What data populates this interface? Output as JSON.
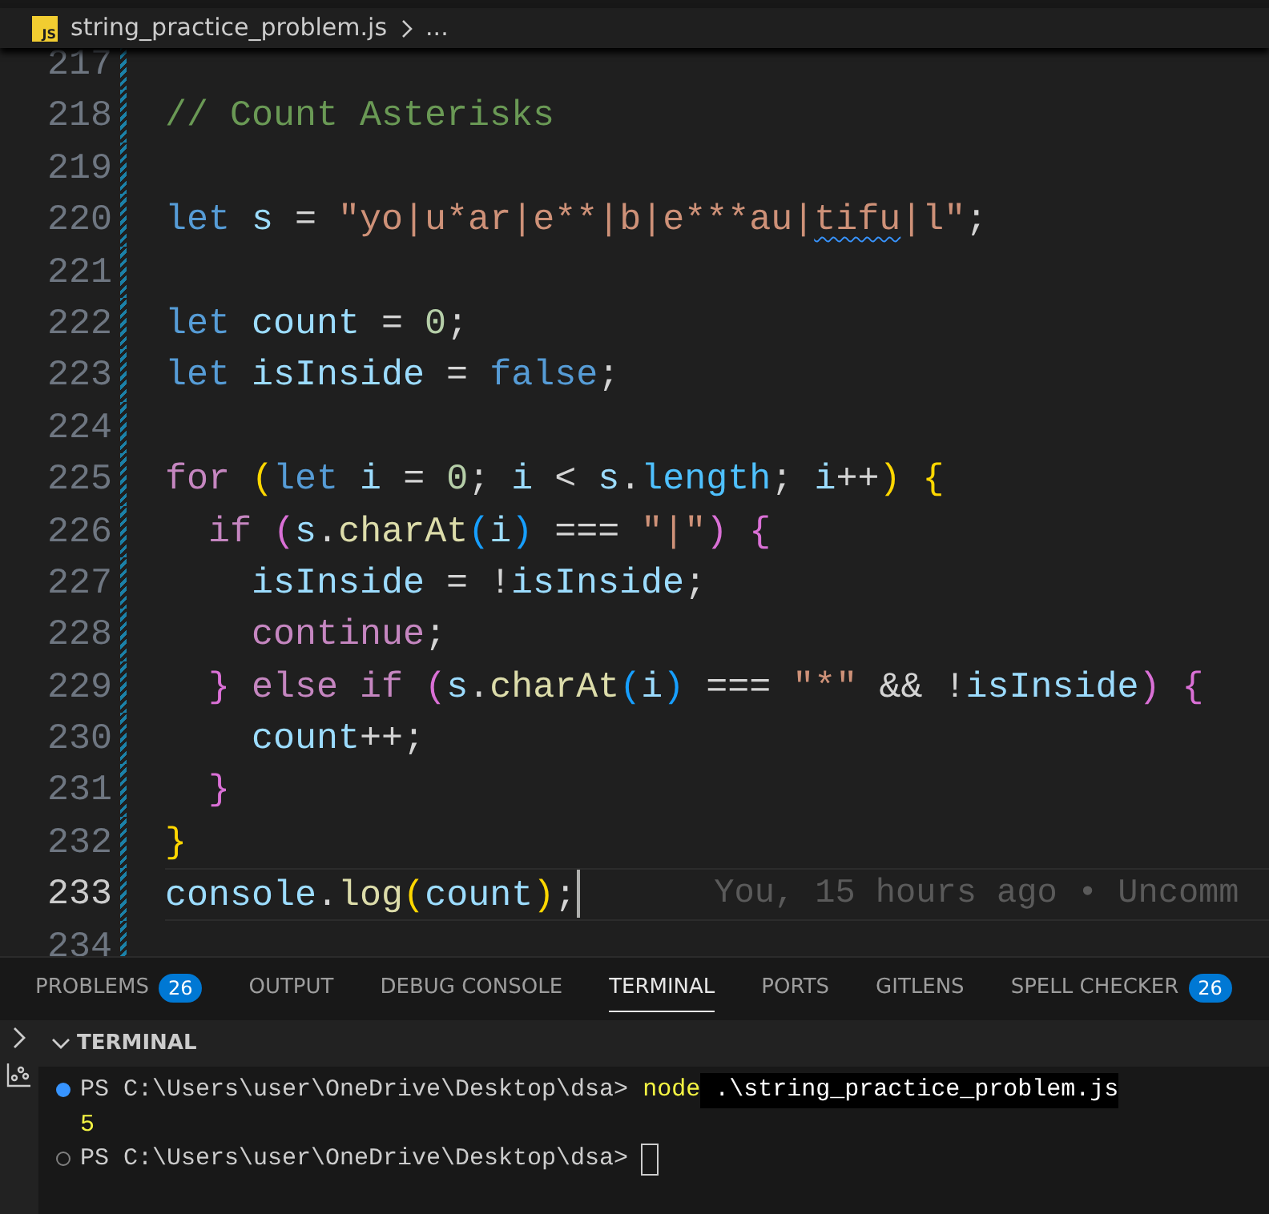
{
  "breadcrumb": {
    "file_icon": "JS",
    "file": "string_practice_problem.js",
    "more": "..."
  },
  "code_lines": [
    {
      "number": "217"
    },
    {
      "number": "218",
      "tokens": [
        {
          "text": "// Count Asterisks",
          "color": "#6a9955"
        }
      ]
    },
    {
      "number": "219"
    },
    {
      "number": "220",
      "tokens": [
        {
          "text": "let",
          "color": "#569cd6"
        },
        {
          "text": " s",
          "color": "#9cdcfe"
        },
        {
          "text": " =",
          "color": "#d4d4d4"
        },
        {
          "text": " \"yo|u*ar|e**|b|e***au|",
          "color": "#ce9178"
        },
        {
          "text": "tifu",
          "color": "#ce9178",
          "squiggle": true
        },
        {
          "text": "|l\"",
          "color": "#ce9178"
        },
        {
          "text": ";",
          "color": "#d4d4d4"
        }
      ]
    },
    {
      "number": "221"
    },
    {
      "number": "222",
      "tokens": [
        {
          "text": "let",
          "color": "#569cd6"
        },
        {
          "text": " count",
          "color": "#9cdcfe"
        },
        {
          "text": " =",
          "color": "#d4d4d4"
        },
        {
          "text": " 0",
          "color": "#b5cea8"
        },
        {
          "text": ";",
          "color": "#d4d4d4"
        }
      ]
    },
    {
      "number": "223",
      "tokens": [
        {
          "text": "let",
          "color": "#569cd6"
        },
        {
          "text": " isInside",
          "color": "#9cdcfe"
        },
        {
          "text": " =",
          "color": "#d4d4d4"
        },
        {
          "text": " false",
          "color": "#569cd6"
        },
        {
          "text": ";",
          "color": "#d4d4d4"
        }
      ]
    },
    {
      "number": "224"
    },
    {
      "number": "225",
      "tokens": [
        {
          "text": "for",
          "color": "#c586c0"
        },
        {
          "text": " (",
          "color": "#ffd700"
        },
        {
          "text": "let",
          "color": "#569cd6"
        },
        {
          "text": " i",
          "color": "#9cdcfe"
        },
        {
          "text": " =",
          "color": "#d4d4d4"
        },
        {
          "text": " 0",
          "color": "#b5cea8"
        },
        {
          "text": ";",
          "color": "#d4d4d4"
        },
        {
          "text": " i",
          "color": "#9cdcfe"
        },
        {
          "text": " <",
          "color": "#d4d4d4"
        },
        {
          "text": " s",
          "color": "#9cdcfe"
        },
        {
          "text": ".",
          "color": "#d4d4d4"
        },
        {
          "text": "length",
          "color": "#4fc1ff"
        },
        {
          "text": ";",
          "color": "#d4d4d4"
        },
        {
          "text": " i",
          "color": "#9cdcfe"
        },
        {
          "text": "++",
          "color": "#d4d4d4"
        },
        {
          "text": ")",
          "color": "#ffd700"
        },
        {
          "text": " {",
          "color": "#ffd700"
        }
      ]
    },
    {
      "number": "226",
      "tokens": [
        {
          "text": "  if",
          "color": "#c586c0"
        },
        {
          "text": " (",
          "color": "#da70d6"
        },
        {
          "text": "s",
          "color": "#9cdcfe"
        },
        {
          "text": ".",
          "color": "#d4d4d4"
        },
        {
          "text": "charAt",
          "color": "#dcdcaa"
        },
        {
          "text": "(",
          "color": "#179fff"
        },
        {
          "text": "i",
          "color": "#9cdcfe"
        },
        {
          "text": ")",
          "color": "#179fff"
        },
        {
          "text": " ===",
          "color": "#d4d4d4"
        },
        {
          "text": " \"|\"",
          "color": "#ce9178"
        },
        {
          "text": ")",
          "color": "#da70d6"
        },
        {
          "text": " {",
          "color": "#da70d6"
        }
      ]
    },
    {
      "number": "227",
      "tokens": [
        {
          "text": "    isInside",
          "color": "#9cdcfe"
        },
        {
          "text": " = !",
          "color": "#d4d4d4"
        },
        {
          "text": "isInside",
          "color": "#9cdcfe"
        },
        {
          "text": ";",
          "color": "#d4d4d4"
        }
      ]
    },
    {
      "number": "228",
      "tokens": [
        {
          "text": "    continue",
          "color": "#c586c0"
        },
        {
          "text": ";",
          "color": "#d4d4d4"
        }
      ]
    },
    {
      "number": "229",
      "tokens": [
        {
          "text": "  }",
          "color": "#da70d6"
        },
        {
          "text": " else",
          "color": "#c586c0"
        },
        {
          "text": " if",
          "color": "#c586c0"
        },
        {
          "text": " (",
          "color": "#da70d6"
        },
        {
          "text": "s",
          "color": "#9cdcfe"
        },
        {
          "text": ".",
          "color": "#d4d4d4"
        },
        {
          "text": "charAt",
          "color": "#dcdcaa"
        },
        {
          "text": "(",
          "color": "#179fff"
        },
        {
          "text": "i",
          "color": "#9cdcfe"
        },
        {
          "text": ")",
          "color": "#179fff"
        },
        {
          "text": " ===",
          "color": "#d4d4d4"
        },
        {
          "text": " \"*\"",
          "color": "#ce9178"
        },
        {
          "text": " && !",
          "color": "#d4d4d4"
        },
        {
          "text": "isInside",
          "color": "#9cdcfe"
        },
        {
          "text": ")",
          "color": "#da70d6"
        },
        {
          "text": " {",
          "color": "#da70d6"
        }
      ]
    },
    {
      "number": "230",
      "tokens": [
        {
          "text": "    count",
          "color": "#9cdcfe"
        },
        {
          "text": "++;",
          "color": "#d4d4d4"
        }
      ]
    },
    {
      "number": "231",
      "tokens": [
        {
          "text": "  }",
          "color": "#da70d6"
        }
      ]
    },
    {
      "number": "232",
      "tokens": [
        {
          "text": "}",
          "color": "#ffd700"
        }
      ]
    },
    {
      "number": "233",
      "current": true,
      "tokens": [
        {
          "text": "console",
          "color": "#9cdcfe"
        },
        {
          "text": ".",
          "color": "#d4d4d4"
        },
        {
          "text": "log",
          "color": "#dcdcaa"
        },
        {
          "text": "(",
          "color": "#ffd700"
        },
        {
          "text": "count",
          "color": "#9cdcfe"
        },
        {
          "text": ")",
          "color": "#ffd700"
        },
        {
          "text": ";",
          "color": "#d4d4d4"
        }
      ],
      "blame": "You, 15 hours ago • Uncomm"
    },
    {
      "number": "234"
    }
  ],
  "panel_tabs": [
    {
      "label": "PROBLEMS",
      "badge": "26",
      "selected": false
    },
    {
      "label": "OUTPUT",
      "selected": false
    },
    {
      "label": "DEBUG CONSOLE",
      "selected": false
    },
    {
      "label": "TERMINAL",
      "selected": true
    },
    {
      "label": "PORTS",
      "selected": false
    },
    {
      "label": "GITLENS",
      "selected": false
    },
    {
      "label": "SPELL CHECKER",
      "badge": "26",
      "selected": false
    }
  ],
  "terminal": {
    "title": "TERMINAL",
    "expanded": true,
    "lines": [
      {
        "kind": "command",
        "succeeded": true,
        "prompt": "PS C:\\Users\\user\\OneDrive\\Desktop\\dsa>",
        "command": "node",
        "args": " .\\string_practice_problem.js"
      },
      {
        "kind": "output",
        "text": "5"
      },
      {
        "kind": "prompt",
        "succeeded": false,
        "prompt": "PS C:\\Users\\user\\OneDrive\\Desktop\\dsa>"
      }
    ]
  }
}
